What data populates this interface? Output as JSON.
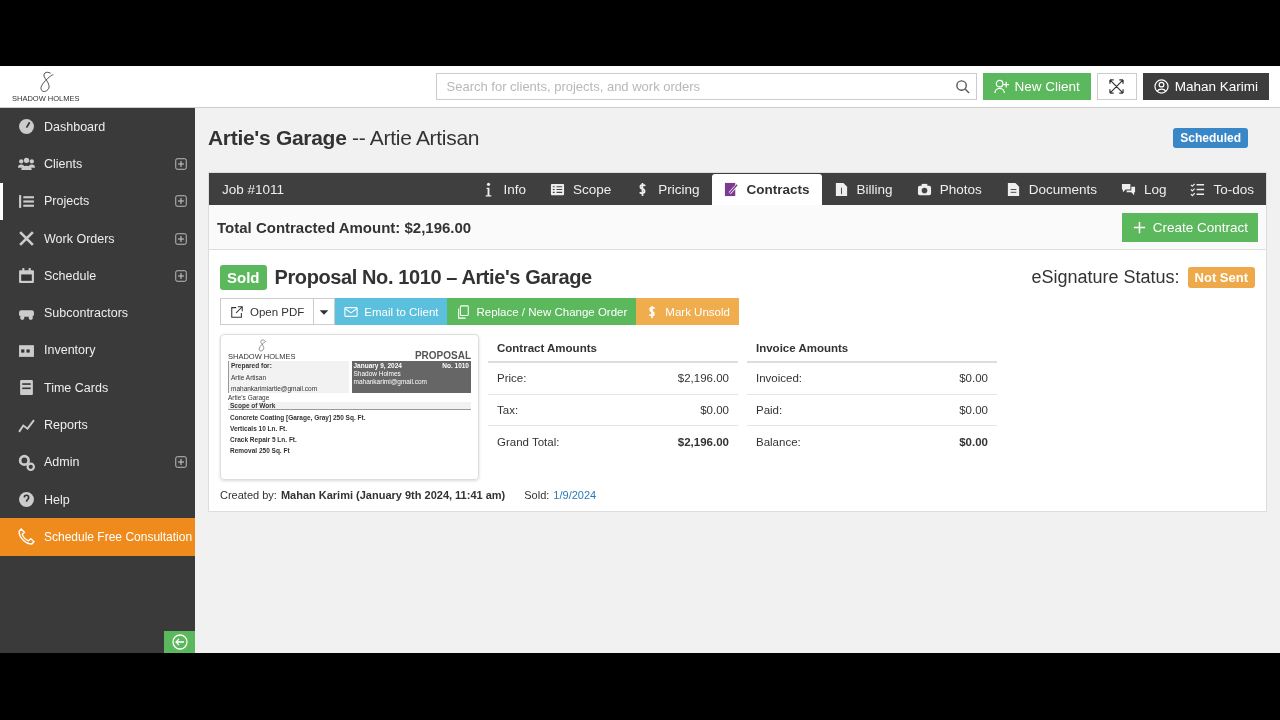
{
  "header": {
    "logo_text": "SHADOW HOLMES",
    "search": {
      "placeholder": "Search for clients, projects, and work orders"
    },
    "new_client": "New Client",
    "user": "Mahan Karimi"
  },
  "sidebar": {
    "items": [
      {
        "label": "Dashboard",
        "selected": false,
        "addable": false
      },
      {
        "label": "Clients",
        "selected": false,
        "addable": true
      },
      {
        "label": "Projects",
        "selected": true,
        "addable": true
      },
      {
        "label": "Work Orders",
        "selected": false,
        "addable": true
      },
      {
        "label": "Schedule",
        "selected": false,
        "addable": true
      },
      {
        "label": "Subcontractors",
        "selected": false,
        "addable": false
      },
      {
        "label": "Inventory",
        "selected": false,
        "addable": false
      },
      {
        "label": "Time Cards",
        "selected": false,
        "addable": false
      },
      {
        "label": "Reports",
        "selected": false,
        "addable": false
      },
      {
        "label": "Admin",
        "selected": false,
        "addable": true
      },
      {
        "label": "Help",
        "selected": false,
        "addable": false
      }
    ],
    "cta": "Schedule Free Consultation"
  },
  "project": {
    "title": "Artie's Garage",
    "client": "-- Artie Artisan",
    "status": "Scheduled"
  },
  "job": {
    "number": "Job #1011",
    "tabs": [
      {
        "label": "Info",
        "selected": false
      },
      {
        "label": "Scope",
        "selected": false
      },
      {
        "label": "Pricing",
        "selected": false
      },
      {
        "label": "Contracts",
        "selected": true
      },
      {
        "label": "Billing",
        "selected": false
      },
      {
        "label": "Photos",
        "selected": false
      },
      {
        "label": "Documents",
        "selected": false
      },
      {
        "label": "Log",
        "selected": false
      },
      {
        "label": "To-dos",
        "selected": false
      }
    ]
  },
  "total": "Total Contracted Amount: $2,196.00",
  "create_contract": "Create Contract",
  "proposal": {
    "badge": "Sold",
    "title": "Proposal No. 1010 – Artie's Garage",
    "esign_label": "eSignature Status:",
    "esign_status": "Not Sent",
    "actions": [
      "Open PDF",
      "Email to Client",
      "Replace / New Change Order",
      "Mark Unsold"
    ],
    "document": {
      "logo_text": "SHADOW HOLMES",
      "heading": "PROPOSAL",
      "prepared_for": "Prepared for:",
      "client_name": "Artie Artisan",
      "client_email": "mahankarimiartie@gmail.com",
      "date": "January 9, 2024",
      "number": "No. 1010",
      "company": "Shadow Holmes",
      "company_email": "mahankarimi@gmail.com",
      "project": "Artie's Garage",
      "scope_heading": "Scope of Work",
      "scope": [
        "Concrete Coating [Garage, Gray] 250 Sq. Ft.",
        "Verticals 10 Ln. Ft.",
        "Crack Repair 5 Ln. Ft.",
        "Removal 250 Sq. Ft"
      ]
    },
    "contract_amounts": {
      "title": "Contract Amounts",
      "rows": [
        {
          "label": "Price:",
          "value": "$2,196.00",
          "bold": false
        },
        {
          "label": "Tax:",
          "value": "$0.00",
          "bold": false
        },
        {
          "label": "Grand Total:",
          "value": "$2,196.00",
          "bold": true
        }
      ]
    },
    "invoice_amounts": {
      "title": "Invoice Amounts",
      "rows": [
        {
          "label": "Invoiced:",
          "value": "$0.00",
          "bold": false
        },
        {
          "label": "Paid:",
          "value": "$0.00",
          "bold": false
        },
        {
          "label": "Balance:",
          "value": "$0.00",
          "bold": true
        }
      ]
    },
    "created_label": "Created by:",
    "created_by": "Mahan Karimi (January 9th 2024, 11:41 am)",
    "sold_label": "Sold:",
    "sold_date": "1/9/2024"
  }
}
